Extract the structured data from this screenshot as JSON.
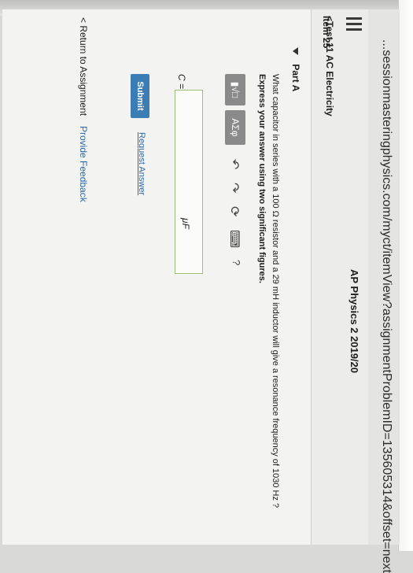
{
  "browser": {
    "url": "...sessionmasteringphysics.com/myct/itemView?assignmentProblemID=135605314&offset=next"
  },
  "header": {
    "menu_icon": "hamburger-icon",
    "course": "AP Physics 2 2019/20",
    "test_link": "<Test 11 AC Electricity",
    "item": "Item 25"
  },
  "part": {
    "title": "Part A",
    "question": "What capacitor in series with a 100 Ω resistor and a 29 mH inductor will give a resonance frequency of 1030 Hz ?",
    "instruction": "Express your answer using two significant figures."
  },
  "toolbar": {
    "template_btn": "▮√□",
    "greek_btn": "ΑΣφ",
    "undo_icon": "undo-icon",
    "redo_icon": "redo-icon",
    "reset_icon": "reset-icon",
    "keyboard_icon": "keyboard-icon",
    "help_label": "?"
  },
  "answer": {
    "label": "C =",
    "value": "",
    "unit": "μF"
  },
  "actions": {
    "submit": "Submit",
    "request": "Request Answer"
  },
  "footer": {
    "return": "< Return to Assignment",
    "feedback": "Provide Feedback"
  },
  "colors": {
    "submit": "#3d7db5",
    "link": "#2a6aa8",
    "input_border": "#9bbf7a"
  }
}
